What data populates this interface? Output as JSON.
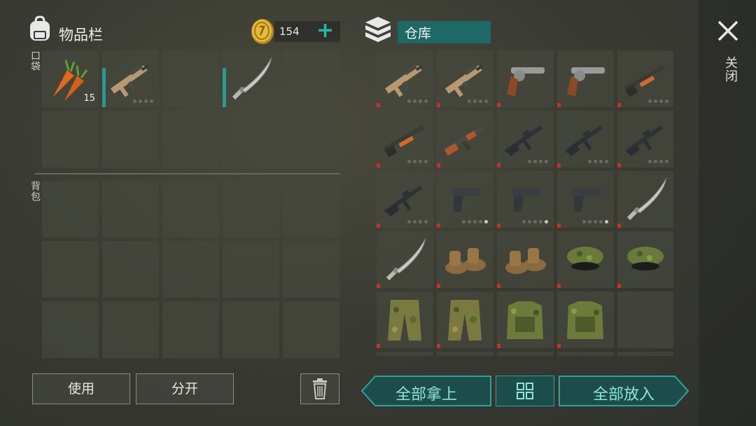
{
  "inventory": {
    "title": "物品栏",
    "pocket_label": "口袋",
    "backpack_label": "背包",
    "coins": "154",
    "add_icon": "plus-icon",
    "pocket_slots": [
      {
        "item": "carrot",
        "qty": "15"
      },
      {
        "item": "assault-rifle-tan",
        "durability": "teal",
        "dots": [
          0,
          0,
          0,
          0
        ]
      },
      {
        "item": ""
      },
      {
        "item": "machete",
        "durability": "teal"
      },
      {
        "item": ""
      },
      {
        "item": ""
      },
      {
        "item": ""
      },
      {
        "item": ""
      },
      {
        "item": ""
      },
      {
        "item": ""
      }
    ],
    "backpack_slots": 15
  },
  "storage": {
    "title": "仓库",
    "slots": [
      {
        "item": "assault-rifle-tan",
        "durability": "red",
        "dots": [
          0,
          0,
          0,
          0
        ]
      },
      {
        "item": "assault-rifle-tan",
        "durability": "red",
        "dots": [
          0,
          0,
          0,
          0
        ]
      },
      {
        "item": "revolver",
        "durability": "red"
      },
      {
        "item": "revolver",
        "durability": "red"
      },
      {
        "item": "shotgun-orange",
        "durability": "red",
        "dots": [
          0,
          0,
          0,
          0
        ]
      },
      {
        "item": "shotgun-orange",
        "durability": "red",
        "dots": [
          0,
          0,
          0,
          0
        ]
      },
      {
        "item": "ak-rifle",
        "durability": "red"
      },
      {
        "item": "m16-rifle",
        "durability": "red",
        "dots": [
          0,
          0,
          0,
          0
        ]
      },
      {
        "item": "m16-rifle",
        "durability": "red",
        "dots": [
          0,
          0,
          0,
          0
        ]
      },
      {
        "item": "m16-rifle",
        "durability": "red",
        "dots": [
          0,
          0,
          0,
          0
        ]
      },
      {
        "item": "m16-rifle",
        "durability": "red",
        "dots": [
          0,
          0,
          0,
          0
        ]
      },
      {
        "item": "pistol",
        "durability": "red",
        "dots": [
          0,
          0,
          0,
          0,
          1
        ]
      },
      {
        "item": "pistol",
        "durability": "red",
        "dots": [
          0,
          0,
          0,
          0,
          1
        ]
      },
      {
        "item": "pistol",
        "durability": "red",
        "dots": [
          0,
          0,
          0,
          0,
          1
        ]
      },
      {
        "item": "machete",
        "durability": "red"
      },
      {
        "item": "machete",
        "durability": "red"
      },
      {
        "item": "boots",
        "durability": "red"
      },
      {
        "item": "boots",
        "durability": "red"
      },
      {
        "item": "camo-cap",
        "durability": "red"
      },
      {
        "item": "camo-cap",
        "durability": "red"
      },
      {
        "item": "camo-pants",
        "durability": "red"
      },
      {
        "item": "camo-pants",
        "durability": "red"
      },
      {
        "item": "camo-vest",
        "durability": "red"
      },
      {
        "item": "camo-vest",
        "durability": "red"
      },
      {
        "item": ""
      }
    ]
  },
  "close_label": "关闭",
  "buttons": {
    "use": "使用",
    "split": "分开",
    "take_all": "全部拿上",
    "put_all": "全部放入"
  },
  "colors": {
    "accent": "#2bb6ad",
    "storage_title_bg": "#1e6865",
    "durability_low": "#c43226",
    "durability_teal": "#2a9a92"
  }
}
